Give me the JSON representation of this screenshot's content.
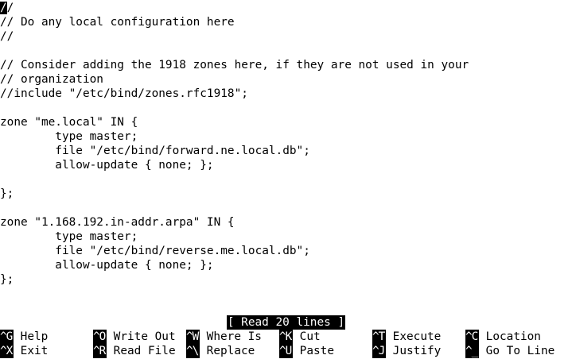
{
  "file_lines": [
    "//",
    "// Do any local configuration here",
    "//",
    "",
    "// Consider adding the 1918 zones here, if they are not used in your",
    "// organization",
    "//include \"/etc/bind/zones.rfc1918\";",
    "",
    "zone \"me.local\" IN {",
    "        type master;",
    "        file \"/etc/bind/forward.ne.local.db\";",
    "        allow-update { none; };",
    "",
    "};",
    "",
    "zone \"1.168.192.in-addr.arpa\" IN {",
    "        type master;",
    "        file \"/etc/bind/reverse.me.local.db\";",
    "        allow-update { none; };",
    "};"
  ],
  "cursor_char": "/",
  "status_message": "[ Read 20 lines ]",
  "shortcuts": {
    "row1": [
      {
        "key": "^G",
        "label": " Help"
      },
      {
        "key": "^O",
        "label": " Write Out"
      },
      {
        "key": "^W",
        "label": " Where Is"
      },
      {
        "key": "^K",
        "label": " Cut"
      },
      {
        "key": "^T",
        "label": " Execute"
      },
      {
        "key": "^C",
        "label": " Location"
      }
    ],
    "row2": [
      {
        "key": "^X",
        "label": " Exit"
      },
      {
        "key": "^R",
        "label": " Read File"
      },
      {
        "key": "^\\",
        "label": " Replace"
      },
      {
        "key": "^U",
        "label": " Paste"
      },
      {
        "key": "^J",
        "label": " Justify"
      },
      {
        "key": "^_",
        "label": " Go To Line"
      }
    ]
  }
}
